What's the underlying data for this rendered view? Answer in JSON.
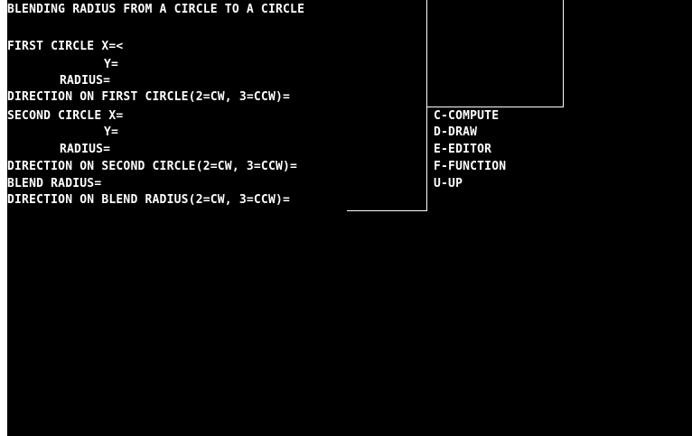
{
  "title": "BLENDING RADIUS FROM A CIRCLE TO A CIRCLE",
  "form": {
    "first_circle_x": "FIRST CIRCLE X=<",
    "first_circle_y": "Y=",
    "first_circle_radius": "RADIUS=",
    "first_direction": "DIRECTION ON FIRST CIRCLE(2=CW, 3=CCW)=",
    "second_circle_x": "SECOND CIRCLE X=",
    "second_circle_y": "Y=",
    "second_circle_radius": "RADIUS=",
    "second_direction": "DIRECTION ON SECOND CIRCLE(2=CW, 3=CCW)=",
    "blend_radius": "BLEND RADIUS=",
    "blend_direction": "DIRECTION ON BLEND RADIUS(2=CW, 3=CCW)="
  },
  "menu": {
    "compute": "C-COMPUTE",
    "draw": "D-DRAW",
    "editor": "E-EDITOR",
    "function": "F-FUNCTION",
    "up": "U-UP"
  },
  "colors": {
    "background": "#000000",
    "foreground": "#ffffff"
  }
}
